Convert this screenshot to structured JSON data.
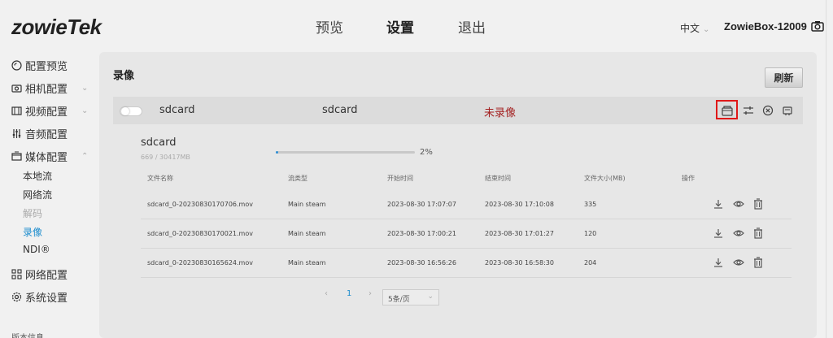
{
  "header": {
    "logo": "zowieTek",
    "nav": [
      "预览",
      "设置",
      "退出"
    ],
    "language": "中文",
    "device_name": "ZowieBox-12009"
  },
  "sidebar": {
    "items": [
      {
        "label": "配置预览",
        "icon": "preview-icon"
      },
      {
        "label": "相机配置",
        "icon": "camera-icon"
      },
      {
        "label": "视频配置",
        "icon": "video-icon"
      },
      {
        "label": "音频配置",
        "icon": "audio-icon"
      },
      {
        "label": "媒体配置",
        "icon": "media-icon"
      },
      {
        "label": "网络配置",
        "icon": "network-icon"
      },
      {
        "label": "系统设置",
        "icon": "settings-icon"
      }
    ],
    "media_sub": [
      "本地流",
      "网络流",
      "解码",
      "录像",
      "NDI®"
    ],
    "footer": "版本信息"
  },
  "main": {
    "title": "录像",
    "refresh_label": "刷新",
    "device_row": {
      "name": "sdcard",
      "type": "sdcard",
      "status": "未录像",
      "status_color": "#a32020"
    },
    "storage": {
      "name": "sdcard",
      "size": "669 / 30417MB",
      "percent": 2,
      "percent_label": "2%"
    },
    "table": {
      "headers": [
        "文件名称",
        "流类型",
        "开始时间",
        "结束时间",
        "文件大小(MB)",
        "操作"
      ],
      "rows": [
        {
          "file": "sdcard_0-20230830170706.mov",
          "stream": "Main steam",
          "start": "2023-08-30 17:07:07",
          "end": "2023-08-30 17:10:08",
          "size": "335"
        },
        {
          "file": "sdcard_0-20230830170021.mov",
          "stream": "Main steam",
          "start": "2023-08-30 17:00:21",
          "end": "2023-08-30 17:01:27",
          "size": "120"
        },
        {
          "file": "sdcard_0-20230830165624.mov",
          "stream": "Main steam",
          "start": "2023-08-30 16:56:26",
          "end": "2023-08-30 16:58:30",
          "size": "204"
        }
      ]
    },
    "pagination": {
      "prev": "‹",
      "current": "1",
      "next": "›",
      "page_size": "5条/页"
    }
  },
  "colors": {
    "accent": "#1b8ccd",
    "highlight": "#e01818"
  }
}
